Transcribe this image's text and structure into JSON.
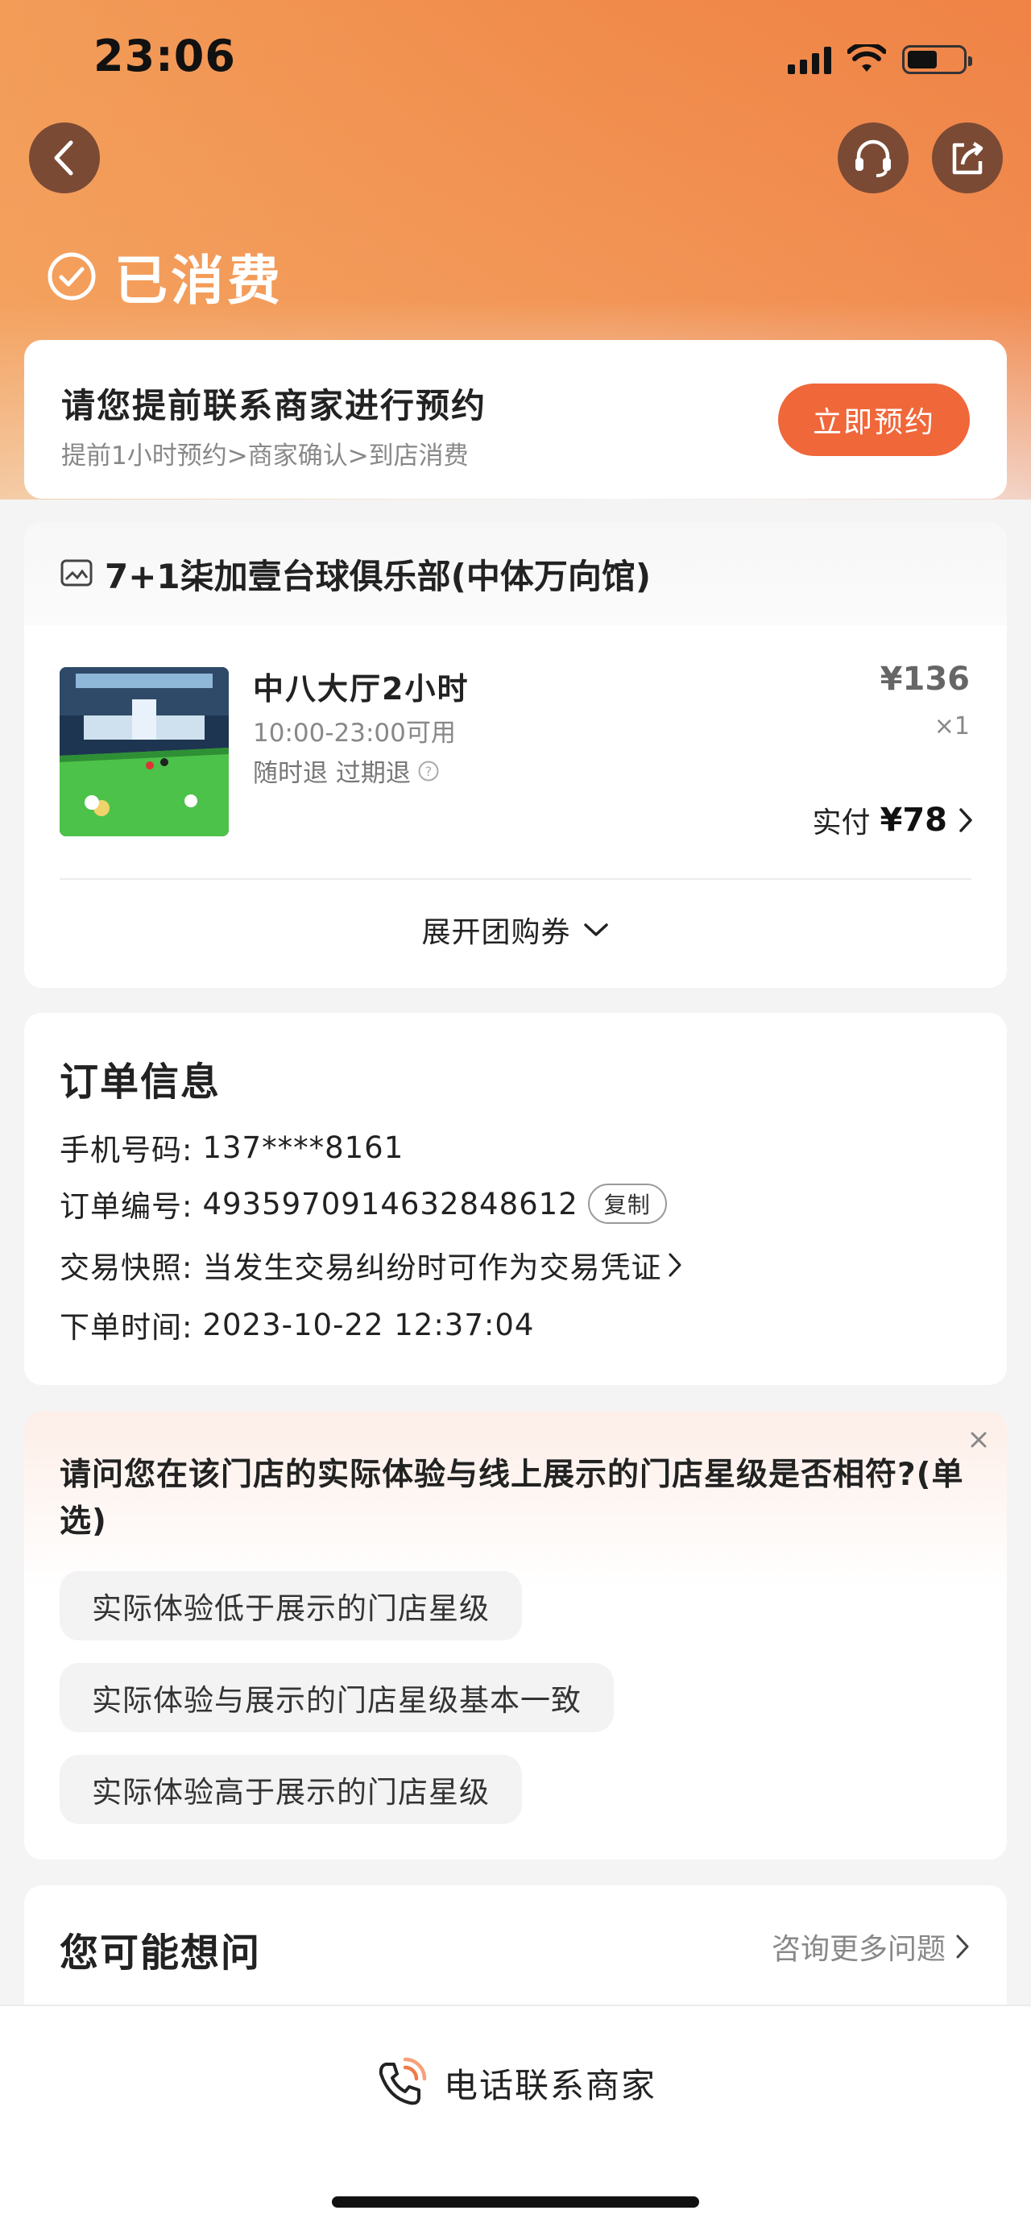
{
  "status_bar": {
    "time": "23:06"
  },
  "header": {
    "status_title": "已消费"
  },
  "booking_card": {
    "title": "请您提前联系商家进行预约",
    "steps": "提前1小时预约>商家确认>到店消费",
    "button_label": "立即预约"
  },
  "shop": {
    "name": "7+1柒加壹台球俱乐部(中体万向馆)",
    "product": {
      "name": "中八大厅2小时",
      "hours": "10:00-23:00可用",
      "refund": "随时退 过期退",
      "price": "¥136",
      "qty": "×1",
      "paid_label": "实付",
      "paid_value": "¥78"
    },
    "expand_label": "展开团购券"
  },
  "order_info": {
    "title": "订单信息",
    "phone_label": "手机号码:",
    "phone_value": "137****8161",
    "order_no_label": "订单编号:",
    "order_no_value": "4935970914632848612",
    "copy_label": "复制",
    "snapshot_label": "交易快照:",
    "snapshot_value": "当发生交易纠纷时可作为交易凭证",
    "time_label": "下单时间:",
    "time_value": "2023-10-22 12:37:04"
  },
  "survey": {
    "question": "请问您在该门店的实际体验与线上展示的门店星级是否相符?(单选)",
    "options": [
      "实际体验低于展示的门店星级",
      "实际体验与展示的门店星级基本一致",
      "实际体验高于展示的门店星级"
    ]
  },
  "faq": {
    "title": "您可能想问",
    "more_label": "咨询更多问题"
  },
  "bottom": {
    "call_label": "电话联系商家"
  },
  "colors": {
    "accent": "#f0673a",
    "hero": "#f08a4a"
  }
}
